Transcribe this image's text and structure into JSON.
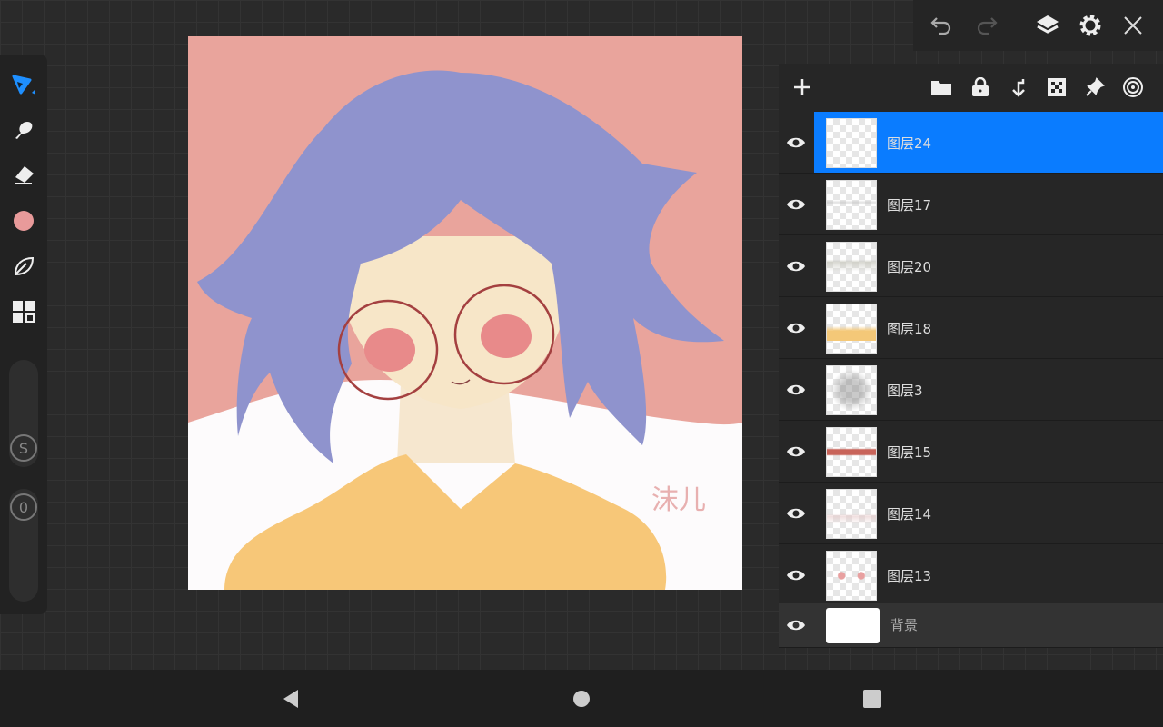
{
  "toolbar": {
    "icons": [
      "undo-icon",
      "redo-icon",
      "layers-icon",
      "settings-icon",
      "close-icon"
    ]
  },
  "left_tools": {
    "icons": [
      "brush-icon",
      "smudge-icon",
      "eraser-icon",
      "color-swatch",
      "leaf-icon",
      "grid-icon"
    ],
    "current_color": "#e89a9a",
    "size_label": "S",
    "opacity_label": "0"
  },
  "layers_panel": {
    "header_icons": [
      "add-icon",
      "folder-icon",
      "lock-icon",
      "merge-down-icon",
      "checker-icon",
      "pin-icon",
      "target-icon"
    ],
    "layers": [
      {
        "name": "图层24",
        "active": true
      },
      {
        "name": "图层17",
        "active": false
      },
      {
        "name": "图层20",
        "active": false
      },
      {
        "name": "图层18",
        "active": false
      },
      {
        "name": "图层3",
        "active": false
      },
      {
        "name": "图层15",
        "active": false
      },
      {
        "name": "图层14",
        "active": false
      },
      {
        "name": "图层13",
        "active": false
      }
    ],
    "background_layer": "背景",
    "accent": "#0a7cff"
  },
  "artwork": {
    "signature": "沫儿"
  }
}
